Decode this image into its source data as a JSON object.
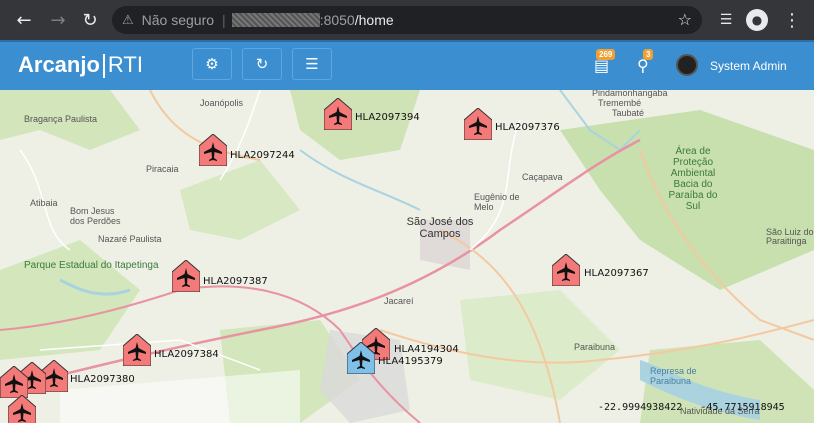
{
  "browser": {
    "security_label": "Não seguro",
    "url_port": ":8050",
    "url_path": "/home"
  },
  "app": {
    "brand_bold": "Arcanjo",
    "brand_light": "RTI",
    "vehicle_count": "269",
    "alert_count": "3",
    "user_name": "System Admin"
  },
  "map": {
    "places": [
      {
        "name": "Bragança Paulista"
      },
      {
        "name": "Joanópolis"
      },
      {
        "name": "Piracaia"
      },
      {
        "name": "Atibaia"
      },
      {
        "name": "Bom Jesus dos Perdões"
      },
      {
        "name": "Nazaré Paulista"
      },
      {
        "name": "Parque Estadual do Itapetinga"
      },
      {
        "name": "São José dos Campos"
      },
      {
        "name": "Eugênio de Melo"
      },
      {
        "name": "Caçapava"
      },
      {
        "name": "Taubaté"
      },
      {
        "name": "Pindamonhangaba"
      },
      {
        "name": "Tremembé"
      },
      {
        "name": "Área de Proteção Ambiental Bacia do Paraíba do Sul"
      },
      {
        "name": "São Luiz do Paraitinga"
      },
      {
        "name": "Jacareí"
      },
      {
        "name": "Paraibuna"
      },
      {
        "name": "Represa de Paraibuna"
      },
      {
        "name": "Natividade da Serra"
      }
    ],
    "aircraft": [
      {
        "label": "HLA2097394",
        "color": "#f47a7a"
      },
      {
        "label": "HLA2097376",
        "color": "#f47a7a"
      },
      {
        "label": "HLA2097244",
        "color": "#f47a7a"
      },
      {
        "label": "HLA2097387",
        "color": "#f47a7a"
      },
      {
        "label": "HLA2097367",
        "color": "#f47a7a"
      },
      {
        "label": "HLA2097384",
        "color": "#f47a7a"
      },
      {
        "label": "HLA4194304",
        "color": "#f47a7a"
      },
      {
        "label": "HLA4195379",
        "color": "#7fc0e8"
      },
      {
        "label": "HLA2097380",
        "color": "#f47a7a"
      }
    ],
    "latitude": "-22.9994938422",
    "longitude": "-45.7715918945"
  },
  "icons": {
    "back": "arrow-left-icon",
    "forward": "arrow-right-icon",
    "reload": "reload-icon",
    "warning": "warning-icon",
    "star": "star-icon",
    "media": "media-control-icon",
    "incognito": "incognito-icon",
    "menu": "kebab-menu-icon",
    "cogs": "cogs-icon",
    "refresh": "refresh-icon",
    "list": "list-icon",
    "car": "car-icon",
    "pin": "map-pin-icon"
  }
}
